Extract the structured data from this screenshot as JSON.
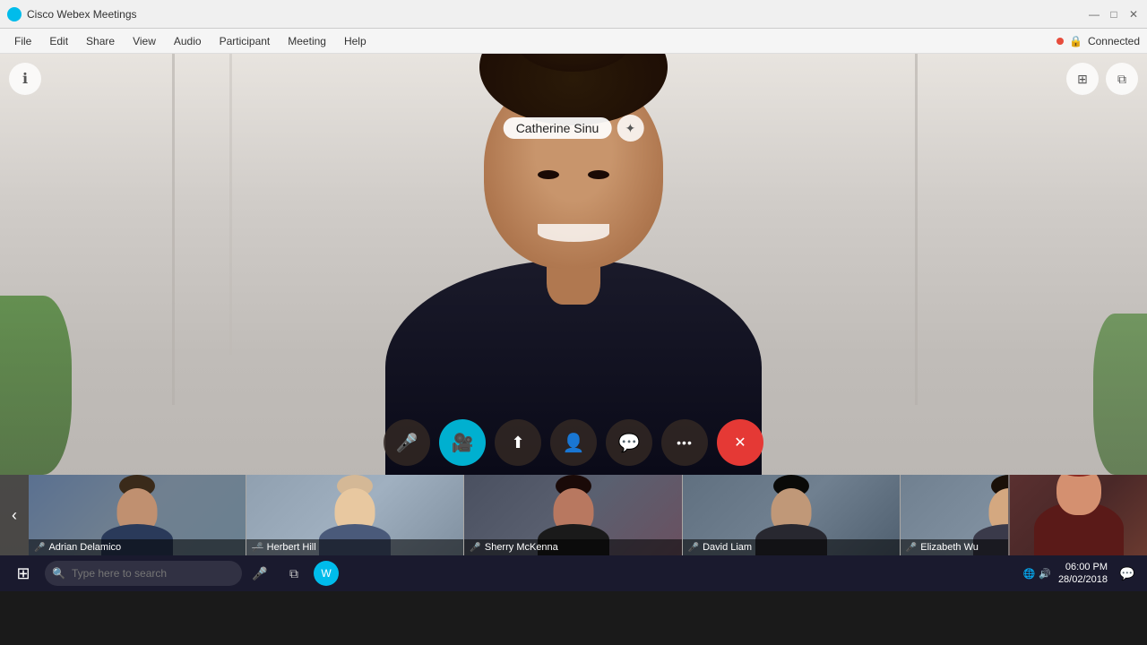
{
  "titlebar": {
    "title": "Cisco Webex Meetings",
    "min_label": "—",
    "max_label": "□",
    "close_label": "✕"
  },
  "menubar": {
    "items": [
      "File",
      "Edit",
      "Share",
      "View",
      "Audio",
      "Participant",
      "Meeting",
      "Help"
    ],
    "connected_label": "Connected"
  },
  "main_video": {
    "participant_name": "Catherine Sinu",
    "info_icon": "ℹ",
    "star_icon": "✦",
    "grid_icon": "⊞",
    "link_icon": "⧉"
  },
  "controls": {
    "mute": "🎤",
    "video": "📷",
    "share": "↑",
    "participants": "👤",
    "chat": "💬",
    "more": "•••",
    "end": "✕"
  },
  "participants": [
    {
      "name": "Adrian Delamico",
      "mic": "🎤",
      "mic_muted": false
    },
    {
      "name": "Herbert Hill",
      "mic": "🎤",
      "mic_muted": true
    },
    {
      "name": "Sherry McKenna",
      "mic": "🎤",
      "mic_muted": false
    },
    {
      "name": "David Liam",
      "mic": "🎤",
      "mic_muted": false
    },
    {
      "name": "Elizabeth Wu",
      "mic": "🎤",
      "mic_muted": false
    }
  ],
  "taskbar": {
    "search_placeholder": "Type here to search",
    "time": "06:00 PM",
    "date": "28/02/2018"
  }
}
